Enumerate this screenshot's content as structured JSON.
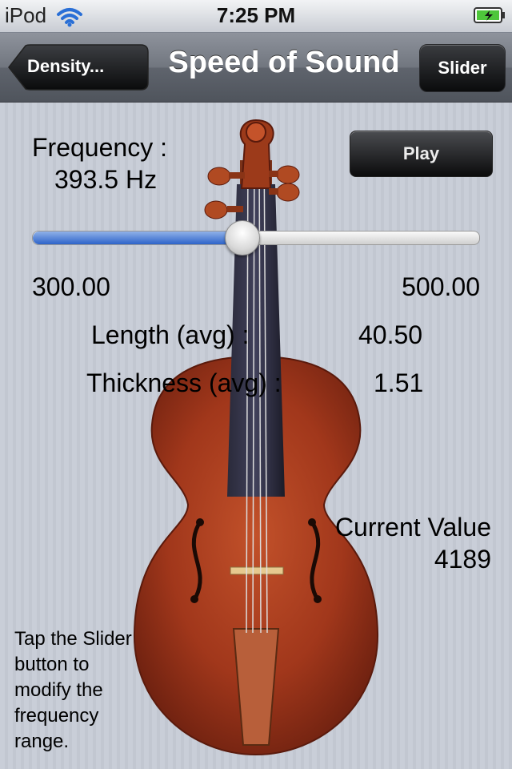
{
  "status_bar": {
    "carrier": "iPod",
    "time": "7:25 PM",
    "icons": [
      "wifi-icon",
      "battery-charging-icon"
    ]
  },
  "nav": {
    "back_label": "Density...",
    "title": "Speed of Sound",
    "right_button_label": "Slider"
  },
  "frequency": {
    "label": "Frequency :",
    "value": "393.5 Hz"
  },
  "play_label": "Play",
  "slider": {
    "min_label": "300.00",
    "max_label": "500.00",
    "min": 300,
    "max": 500,
    "value": 393.5
  },
  "length": {
    "label": "Length (avg) :",
    "value": "40.50"
  },
  "thickness": {
    "label": "Thickness (avg) :",
    "value": "1.51"
  },
  "current_value": {
    "label": "Current Value",
    "value": "4189"
  },
  "help_text": "Tap the Slider button to modify the frequency range.",
  "colors": {
    "slider_fill": "#2d63c9",
    "violin_body": "#a1371b"
  }
}
